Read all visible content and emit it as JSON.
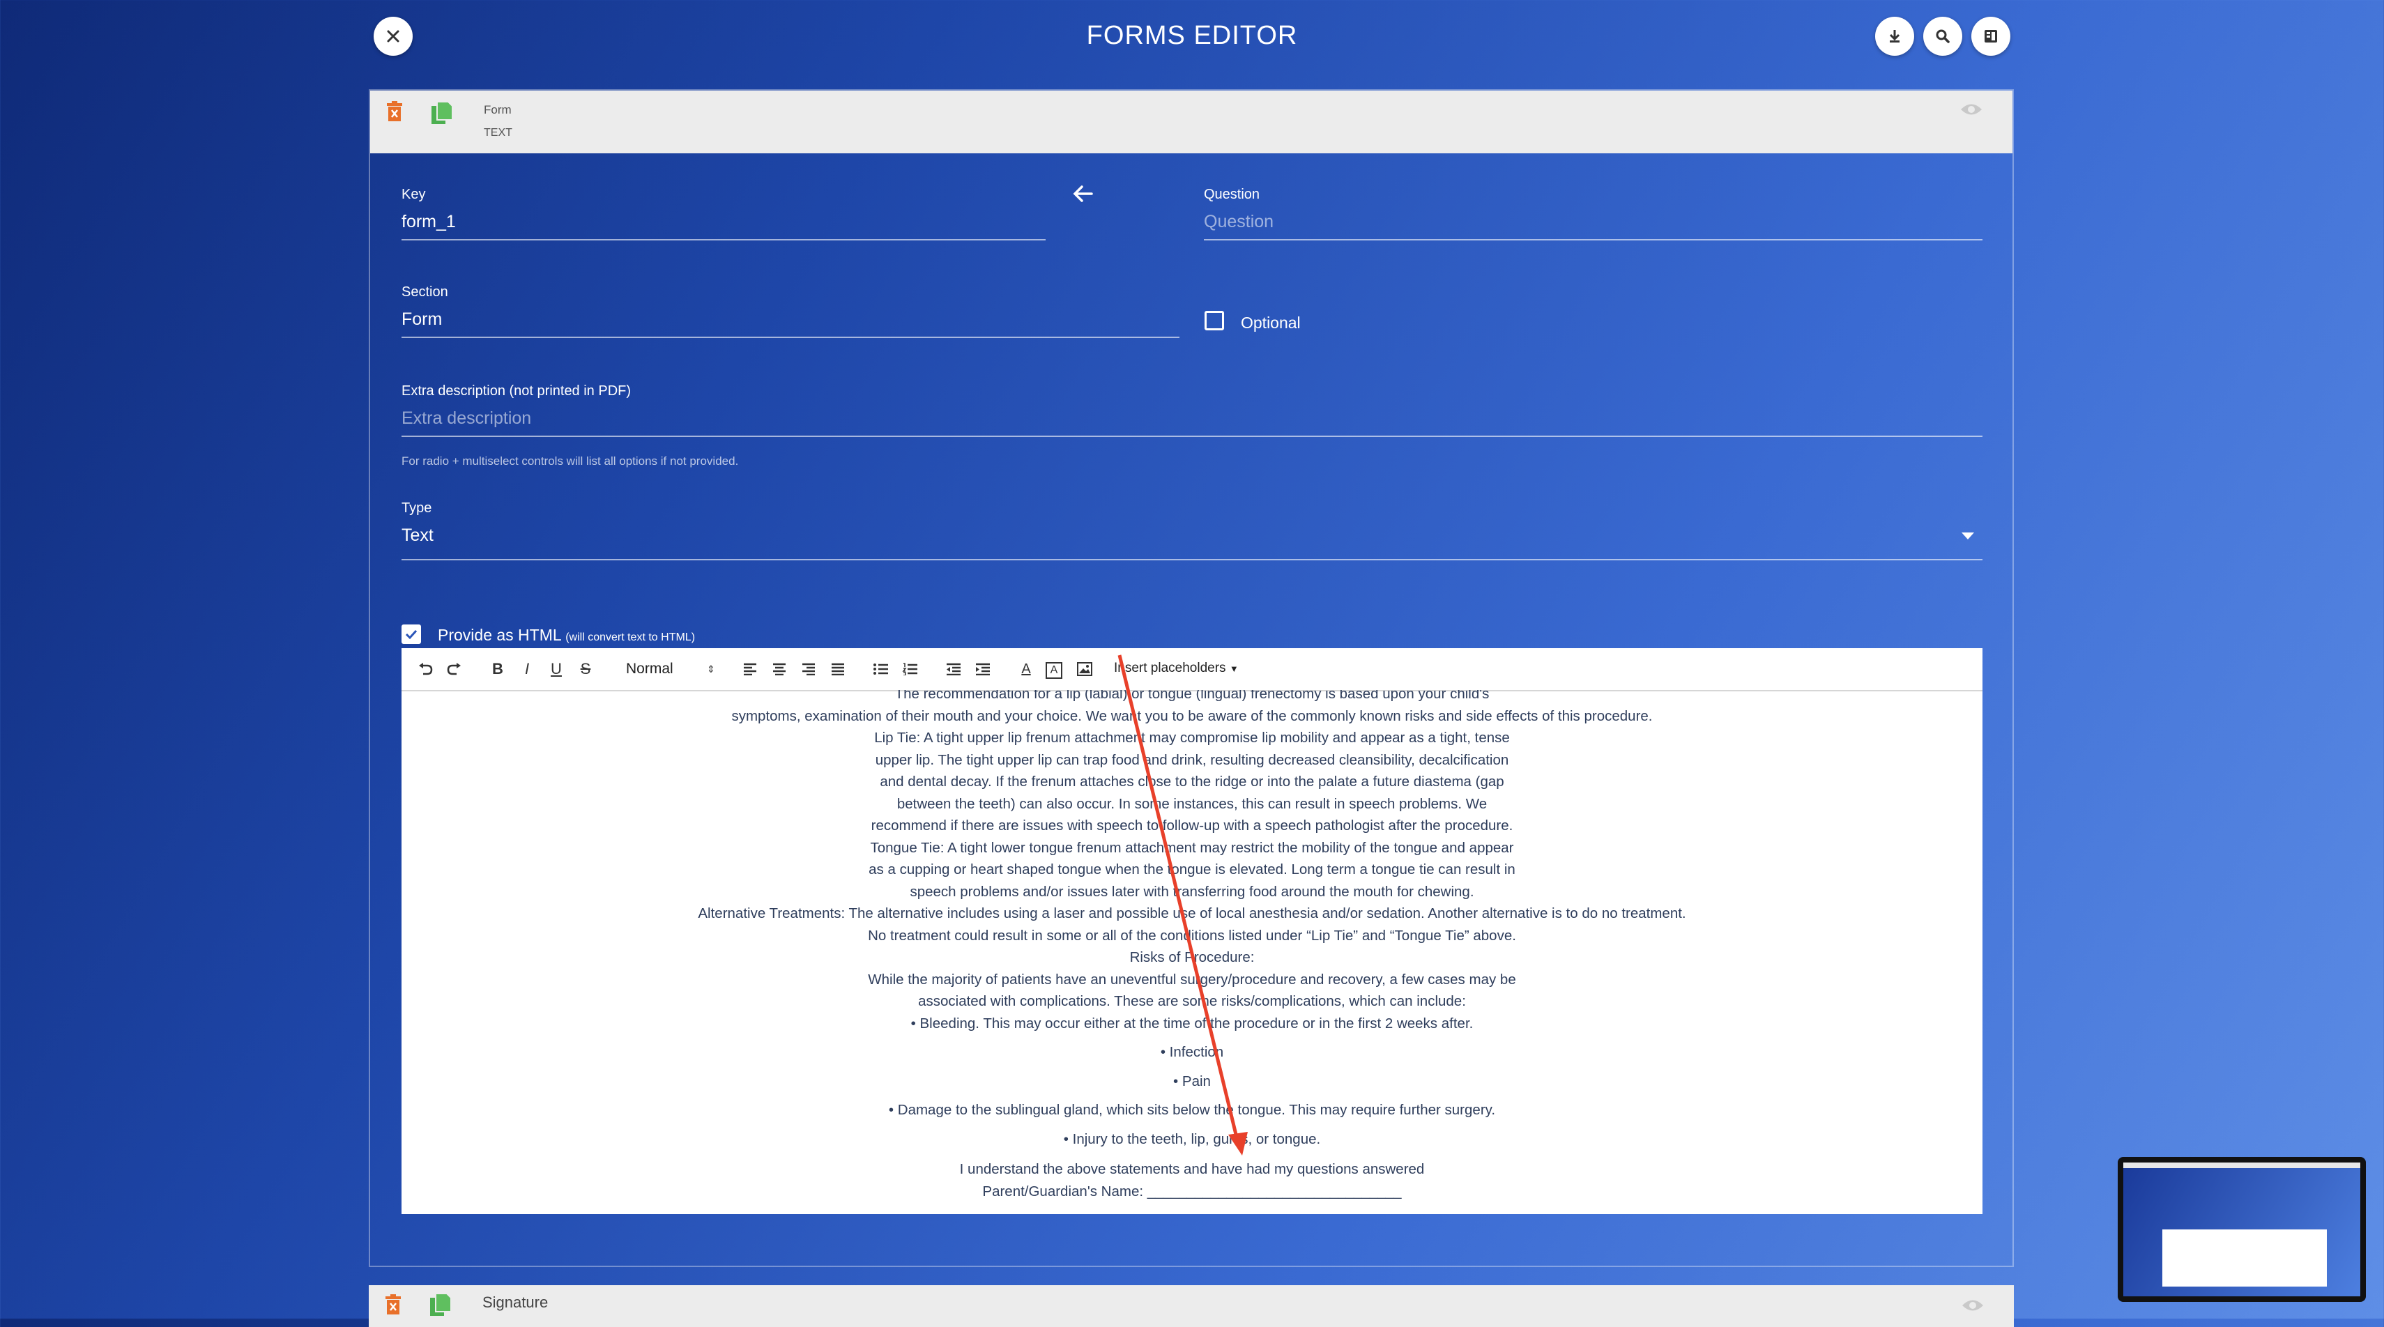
{
  "app": {
    "title": "FORMS EDITOR"
  },
  "panel": {
    "header_name": "Form",
    "header_type": "TEXT",
    "key_label": "Key",
    "key_value": "form_1",
    "question_label": "Question",
    "question_placeholder": "Question",
    "section_label": "Section",
    "section_value": "Form",
    "optional_label": "Optional",
    "extra_label": "Extra description (not printed in PDF)",
    "extra_placeholder": "Extra description",
    "extra_hint": "For radio + multiselect controls will list all options if not provided.",
    "type_label": "Type",
    "type_value": "Text",
    "html_label": "Provide as HTML",
    "html_note": "(will convert text to HTML)"
  },
  "toolbar": {
    "format_value": "Normal",
    "placeholders_label": "Insert placeholders"
  },
  "editor_lines": [
    "The recommendation for a lip (labial) or tongue (lingual) frenectomy is based upon your child's",
    "symptoms, examination of their mouth and your choice. We want you to be aware of the commonly known risks and side effects of this procedure.",
    "Lip Tie: A tight upper lip frenum attachment may compromise lip mobility and appear as a tight, tense",
    "upper lip. The tight upper lip can trap food and drink, resulting decreased cleansibility, decalcification",
    "and dental decay. If the frenum attaches close to the ridge or into the palate a future diastema (gap",
    "between the teeth) can also occur. In some instances, this can result in speech problems. We",
    "recommend if there are issues with speech to follow-up with a speech pathologist after the procedure.",
    "Tongue Tie: A tight lower tongue frenum attachment may restrict the mobility of the tongue and appear",
    "as a cupping or heart shaped tongue when the tongue is elevated. Long term a tongue tie can result in",
    "speech problems and/or issues later with transferring food around the mouth for chewing.",
    "Alternative Treatments: The alternative includes using a laser and possible use of local anesthesia and/or sedation. Another alternative is to do no treatment.",
    "No treatment could result in some or all of the conditions listed under “Lip Tie” and “Tongue Tie” above.",
    "Risks of Procedure:",
    "While the majority of patients have an uneventful surgery/procedure and recovery, a few cases may be",
    "associated with complications. These are some risks/complications, which can include:",
    "• Bleeding. This may occur either at the time of the procedure or in the first 2 weeks after.",
    "• Infection",
    "• Pain",
    "• Damage to the sublingual gland, which sits below the tongue. This may require further surgery.",
    "• Injury to the teeth, lip, gums, or tongue.",
    "I understand the above statements and have had my questions answered",
    "Parent/Guardian's Name: ________________________________"
  ],
  "next_panel": {
    "header_name": "Signature"
  },
  "icons": {
    "close": "close-icon",
    "download": "download-icon",
    "search": "search-icon",
    "layout": "layout-icon",
    "delete": "trash-icon",
    "copy": "copy-icon",
    "visibility": "eye-icon",
    "back": "arrow-left-icon"
  },
  "colors": {
    "delete_icon": "#e8702a",
    "copy_icon": "#4caf50",
    "annotation_arrow": "#e8402a"
  }
}
